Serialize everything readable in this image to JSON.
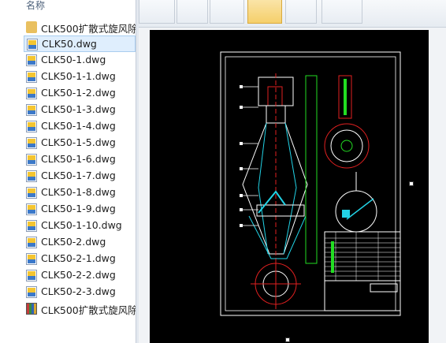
{
  "file_list": {
    "column_header": "名称",
    "items": [
      {
        "name": "CLK500扩散式旋风除",
        "icon": "folder-icon"
      },
      {
        "name": "CLK50.dwg",
        "icon": "dwg-file-icon",
        "selected": true
      },
      {
        "name": "CLK50-1.dwg",
        "icon": "dwg-file-icon"
      },
      {
        "name": "CLK50-1-1.dwg",
        "icon": "dwg-file-icon"
      },
      {
        "name": "CLK50-1-2.dwg",
        "icon": "dwg-file-icon"
      },
      {
        "name": "CLK50-1-3.dwg",
        "icon": "dwg-file-icon"
      },
      {
        "name": "CLK50-1-4.dwg",
        "icon": "dwg-file-icon"
      },
      {
        "name": "CLK50-1-5.dwg",
        "icon": "dwg-file-icon"
      },
      {
        "name": "CLK50-1-6.dwg",
        "icon": "dwg-file-icon"
      },
      {
        "name": "CLK50-1-7.dwg",
        "icon": "dwg-file-icon"
      },
      {
        "name": "CLK50-1-8.dwg",
        "icon": "dwg-file-icon"
      },
      {
        "name": "CLK50-1-9.dwg",
        "icon": "dwg-file-icon"
      },
      {
        "name": "CLK50-1-10.dwg",
        "icon": "dwg-file-icon"
      },
      {
        "name": "CLK50-2.dwg",
        "icon": "dwg-file-icon"
      },
      {
        "name": "CLK50-2-1.dwg",
        "icon": "dwg-file-icon"
      },
      {
        "name": "CLK50-2-2.dwg",
        "icon": "dwg-file-icon"
      },
      {
        "name": "CLK50-2-3.dwg",
        "icon": "dwg-file-icon"
      },
      {
        "name": "CLK500扩散式旋风除",
        "icon": "rar-archive-icon"
      }
    ]
  },
  "colors": {
    "canvas": "#000000",
    "outline": "#ffffff",
    "cyan": "#22d3e6",
    "red": "#e02020",
    "green": "#22dd22",
    "selection": "#dfeefd"
  }
}
